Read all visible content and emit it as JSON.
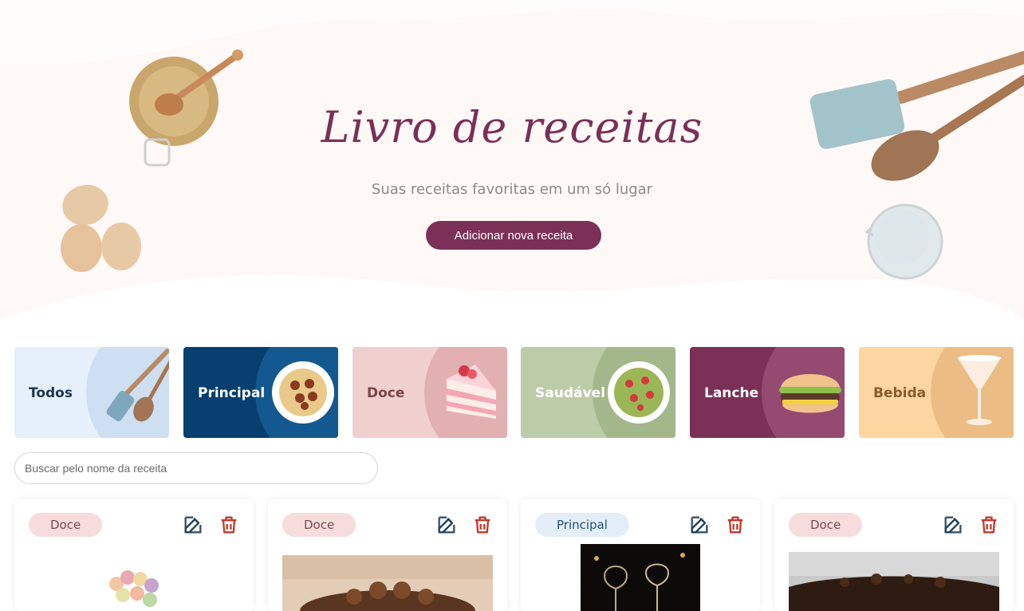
{
  "hero": {
    "title": "Livro de receitas",
    "subtitle": "Suas receitas favoritas em um só lugar",
    "add_button": "Adicionar nova receita"
  },
  "categories": [
    {
      "label": "Todos",
      "bg": "#e6f0fa",
      "circle": "#cddff0",
      "text": "#1f3550",
      "icon": "spatula-spoon-icon"
    },
    {
      "label": "Principal",
      "bg": "#063f70",
      "circle": "#13598f",
      "text": "#ffffff",
      "icon": "spaghetti-icon"
    },
    {
      "label": "Doce",
      "bg": "#f0cfcf",
      "circle": "#e2b0b0",
      "text": "#7a4545",
      "icon": "cake-slice-icon"
    },
    {
      "label": "Saudável",
      "bg": "#bccca8",
      "circle": "#a3b78a",
      "text": "#ffffff",
      "icon": "salad-icon"
    },
    {
      "label": "Lanche",
      "bg": "#7b3058",
      "circle": "#954a71",
      "text": "#ffffff",
      "icon": "burger-icon"
    },
    {
      "label": "Bebida",
      "bg": "#fcd5a0",
      "circle": "#ebbd84",
      "text": "#8a5a2b",
      "icon": "cocktail-icon"
    }
  ],
  "search": {
    "placeholder": "Buscar pelo nome da receita"
  },
  "cards": [
    {
      "category": "Doce",
      "category_style": "doce",
      "image": "macarons-photo"
    },
    {
      "category": "Doce",
      "category_style": "doce",
      "image": "chocolate-cake-photo"
    },
    {
      "category": "Principal",
      "category_style": "principal",
      "image": "wine-glasses-photo"
    },
    {
      "category": "Doce",
      "category_style": "doce",
      "image": "chocolate-cake-photo"
    }
  ],
  "colors": {
    "accent": "#7b3058",
    "edit": "#1e3f5a",
    "delete": "#c0392b"
  }
}
